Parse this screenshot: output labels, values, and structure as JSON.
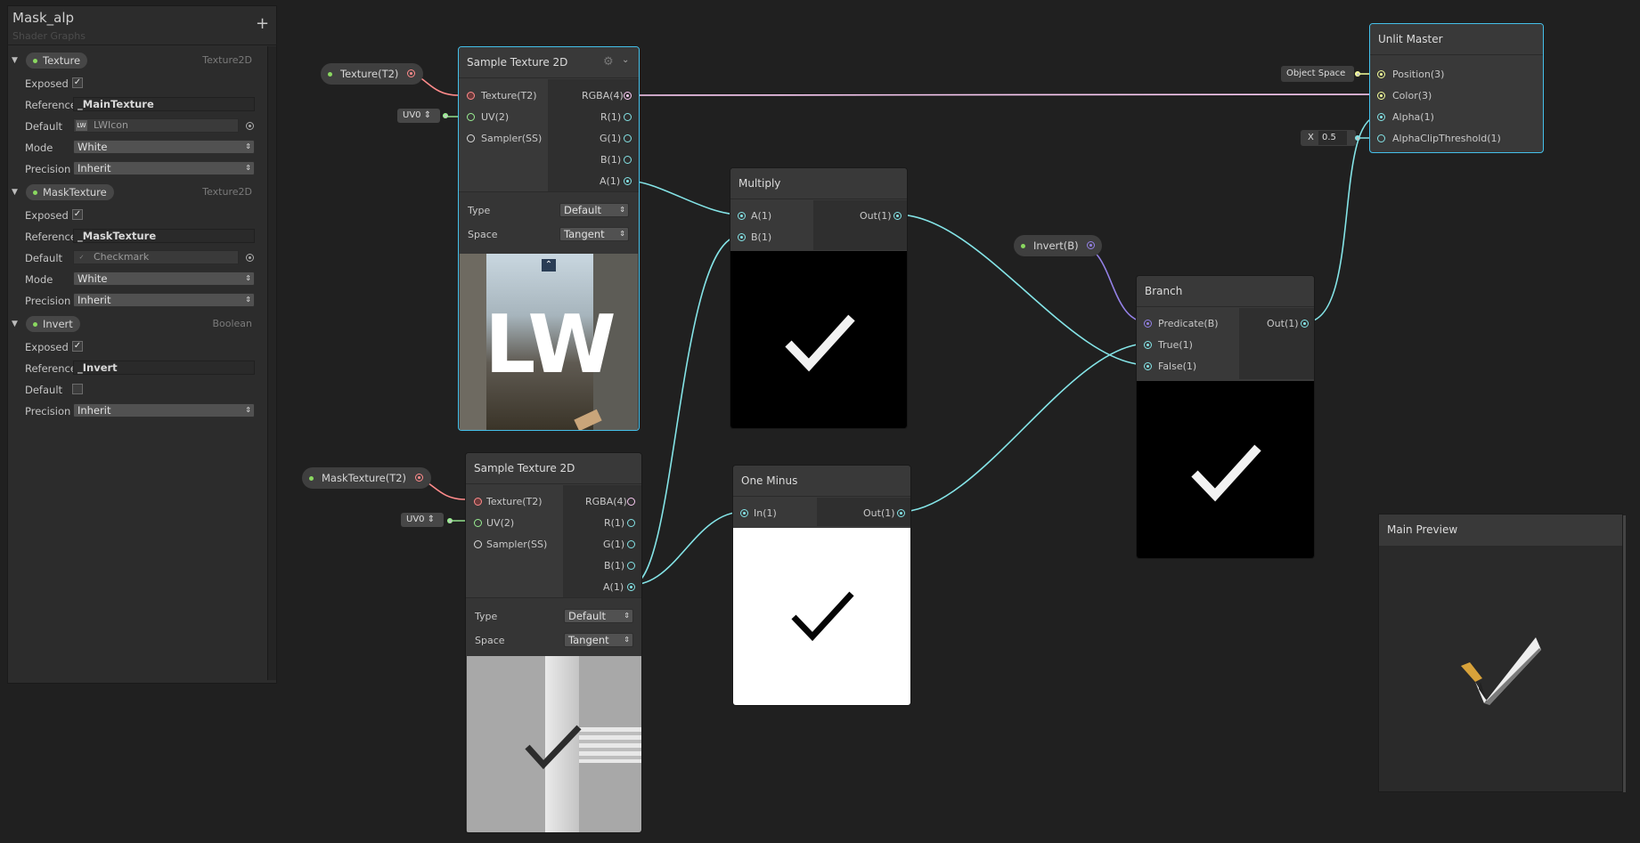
{
  "blackboard": {
    "title": "Mask_alp",
    "subtitle": "Shader Graphs",
    "add_icon": "+",
    "properties": [
      {
        "name": "Texture",
        "type": "Texture2D",
        "exposed": true,
        "reference": "_MainTexture",
        "default_label": "Default",
        "default": "LWIcon",
        "mode": "White",
        "precision": "Inherit"
      },
      {
        "name": "MaskTexture",
        "type": "Texture2D",
        "exposed": true,
        "reference": "_MaskTexture",
        "default_label": "Default",
        "default": "Checkmark",
        "mode": "White",
        "precision": "Inherit"
      },
      {
        "name": "Invert",
        "type": "Boolean",
        "exposed": true,
        "reference": "_Invert",
        "default_label": "Default",
        "default": false,
        "precision": "Inherit"
      }
    ],
    "labels": {
      "exposed": "Exposed",
      "reference": "Reference",
      "mode": "Mode",
      "precision": "Precision"
    }
  },
  "graph": {
    "property_nodes": {
      "texture": "Texture(T2)",
      "mask_texture": "MaskTexture(T2)",
      "invert": "Invert(B)"
    },
    "uv_inputs": [
      "UV0",
      "UV0"
    ],
    "object_space": "Object Space",
    "alpha_clip": {
      "axis": "X",
      "value": "0.5"
    },
    "sample1": {
      "title": "Sample Texture 2D",
      "inputs": [
        "Texture(T2)",
        "UV(2)",
        "Sampler(SS)"
      ],
      "outputs": [
        "RGBA(4)",
        "R(1)",
        "G(1)",
        "B(1)",
        "A(1)"
      ],
      "type_label": "Type",
      "type": "Default",
      "space_label": "Space",
      "space": "Tangent",
      "preview_text": "LW"
    },
    "sample2": {
      "title": "Sample Texture 2D",
      "inputs": [
        "Texture(T2)",
        "UV(2)",
        "Sampler(SS)"
      ],
      "outputs": [
        "RGBA(4)",
        "R(1)",
        "G(1)",
        "B(1)",
        "A(1)"
      ],
      "type_label": "Type",
      "type": "Default",
      "space_label": "Space",
      "space": "Tangent"
    },
    "multiply": {
      "title": "Multiply",
      "inputs": [
        "A(1)",
        "B(1)"
      ],
      "output": "Out(1)"
    },
    "one_minus": {
      "title": "One Minus",
      "inputs": [
        "In(1)"
      ],
      "output": "Out(1)"
    },
    "branch": {
      "title": "Branch",
      "inputs": [
        "Predicate(B)",
        "True(1)",
        "False(1)"
      ],
      "output": "Out(1)"
    },
    "master": {
      "title": "Unlit Master",
      "inputs": [
        "Position(3)",
        "Color(3)",
        "Alpha(1)",
        "AlphaClipThreshold(1)"
      ]
    },
    "main_preview": {
      "title": "Main Preview"
    }
  },
  "colors": {
    "vector1": "#84e4e7",
    "texture": "#ff8b8b",
    "boolean": "#9481e6",
    "vector3": "#f6ff9a",
    "vector4": "#fbcbf4",
    "vector2": "#9aef92",
    "sampler": "#dcdcdc",
    "selection": "#44c0ea",
    "background": "#202020"
  }
}
